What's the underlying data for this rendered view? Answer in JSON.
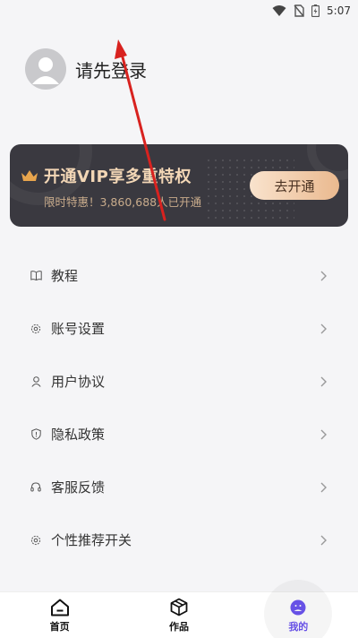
{
  "status_bar": {
    "time": "5:07",
    "icons": [
      "wifi-icon",
      "no-sim-icon",
      "battery-charging-icon"
    ]
  },
  "profile": {
    "login_prompt": "请先登录",
    "avatar_icon": "default-avatar-icon"
  },
  "vip_card": {
    "title": "开通VIP享多重特权",
    "subtitle": "限时特惠！3,860,688人已开通",
    "button_label": "去开通",
    "icon": "crown-icon",
    "colors": {
      "card_bg": "#3a3940",
      "title": "#f3d7b6",
      "button_from": "#f9e3cd",
      "button_to": "#eab98f"
    }
  },
  "menu": {
    "items": [
      {
        "label": "教程",
        "icon": "book-icon"
      },
      {
        "label": "账号设置",
        "icon": "gear-icon"
      },
      {
        "label": "用户协议",
        "icon": "user-icon"
      },
      {
        "label": "隐私政策",
        "icon": "shield-icon"
      },
      {
        "label": "客服反馈",
        "icon": "headset-icon"
      },
      {
        "label": "个性推荐开关",
        "icon": "gear-icon"
      }
    ]
  },
  "tabs": [
    {
      "label": "首页",
      "icon": "home-icon",
      "active": false
    },
    {
      "label": "作品",
      "icon": "cube-icon",
      "active": false
    },
    {
      "label": "我的",
      "icon": "profile-face-icon",
      "active": true
    }
  ],
  "accent_color": "#6c55f0"
}
